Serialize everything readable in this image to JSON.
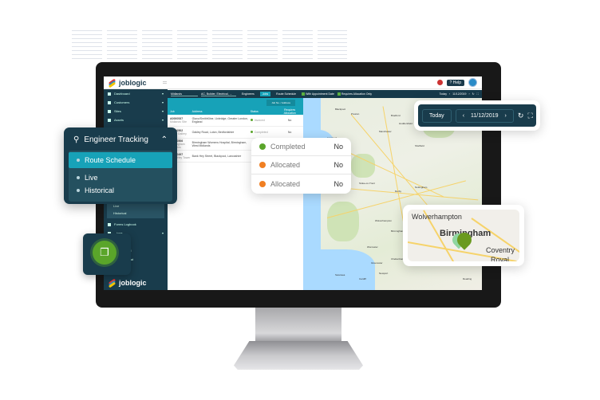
{
  "app": {
    "brand": "joblogic",
    "help_label": "Help"
  },
  "sidebar": {
    "items": [
      {
        "label": "Dashboard",
        "icon": "dashboard-icon"
      },
      {
        "label": "Customers",
        "icon": "user-icon"
      },
      {
        "label": "Sites",
        "icon": "building-icon"
      },
      {
        "label": "Assets",
        "icon": "asset-icon"
      }
    ],
    "sub_items": [
      "Live",
      "Historical"
    ],
    "lower_items": [
      {
        "label": "Forms Logbook"
      },
      {
        "label": "...ions"
      }
    ],
    "partial_items": [
      "...gs",
      "...Feed",
      "...e Chat"
    ],
    "footer_brand": "joblogic"
  },
  "toolbar": {
    "region_label": "Region",
    "region_value": "Midlands",
    "trade_label": "Trade(s)",
    "trade_value": "AC, Builder, Electrical, ...",
    "engineers_label": "Engineers",
    "jobs_label": "Jobs",
    "route_schedule_label": "Route Schedule",
    "with_appointment_label": "With Appointment Date",
    "requires_allocation_label": "Requires Allocation Only",
    "today_label": "Today",
    "date": "11/12/2019"
  },
  "table": {
    "search_label": "Job No. / Address",
    "headers": [
      "Job",
      "Address",
      "Status",
      "Requires Allocation"
    ],
    "rows": [
      {
        "job": "A0000537",
        "sub": "Midlands Site",
        "address": "Glaxo/SmithKline, Uxbridge, Greater London, England",
        "status": "Invoiced",
        "status_color": "#5aa52a",
        "alloc": "No"
      },
      {
        "job": "A0000502",
        "sub": "Luton Gallery",
        "address": "Oakley Road, Luton, Bedfordshire",
        "status": "Completed",
        "status_color": "#5aa52a",
        "alloc": "No"
      },
      {
        "job": "A0000506",
        "sub": "Birmingham Womens",
        "address": "Birmingham Womens Hospital, Birmingham, West Midlands",
        "status": "",
        "status_color": "",
        "alloc": ""
      },
      {
        "job": "A0000497",
        "sub": "Bank Hey Tower",
        "address": "Bank Hey Street, Blackpool, Lancashire",
        "status": "",
        "status_color": "",
        "alloc": ""
      }
    ]
  },
  "engineer_tracking": {
    "title": "Engineer Tracking",
    "items": [
      {
        "label": "Route Schedule",
        "active": true
      },
      {
        "label": "Live",
        "active": false
      },
      {
        "label": "Historical",
        "active": false
      }
    ]
  },
  "status_card": {
    "rows": [
      {
        "status": "Completed",
        "color": "#5aa52a",
        "value": "No"
      },
      {
        "status": "Allocated",
        "color": "#f07f22",
        "value": "No"
      },
      {
        "status": "Allocated",
        "color": "#f07f22",
        "value": "No"
      }
    ]
  },
  "date_card": {
    "today_label": "Today",
    "date": "11/12/2019"
  },
  "map_card": {
    "labels": [
      "Wolverhampton",
      "Birmingham",
      "Coventry",
      "Royal"
    ]
  },
  "map": {
    "cities": [
      "Blackpool",
      "Preston",
      "Manchester",
      "Liverpool",
      "Sheffield",
      "Chester",
      "Stoke-on-Trent",
      "Nottingham",
      "Derby",
      "Leicester",
      "Wolverhampton",
      "Birmingham",
      "Worcester",
      "Gloucester",
      "Cheltenham",
      "Cardiff",
      "Newport",
      "Swansea",
      "Reading",
      "Oxford",
      "Huddersfield",
      "Bradford"
    ]
  },
  "colors": {
    "navy": "#193c4c",
    "teal": "#17a2b8",
    "green": "#5aa52a",
    "orange": "#f07f22"
  }
}
